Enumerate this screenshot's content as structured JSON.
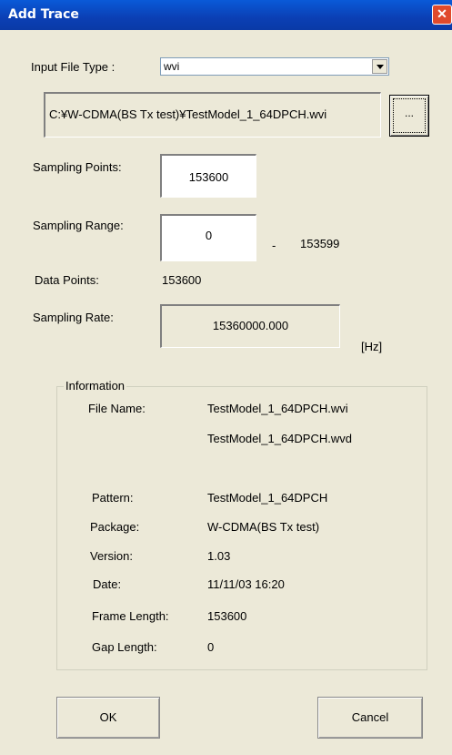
{
  "window": {
    "title": "Add Trace",
    "close_glyph": "✕"
  },
  "input_file_type": {
    "label": "Input File Type :",
    "value": "wvi"
  },
  "file_path": "C:¥W-CDMA(BS Tx test)¥TestModel_1_64DPCH.wvi",
  "browse_label": "...",
  "sampling_points": {
    "label": "Sampling Points:",
    "value": "153600"
  },
  "sampling_range": {
    "label": "Sampling Range:",
    "start": "0",
    "separator": "-",
    "end": "153599"
  },
  "data_points": {
    "label": "Data Points:",
    "value": "153600"
  },
  "sampling_rate": {
    "label": "Sampling Rate:",
    "value": "15360000.000",
    "unit": "[Hz]"
  },
  "information": {
    "title": "Information",
    "file_name_label": "File Name:",
    "file_name_1": "TestModel_1_64DPCH.wvi",
    "file_name_2": "TestModel_1_64DPCH.wvd",
    "pattern_label": "Pattern:",
    "pattern": "TestModel_1_64DPCH",
    "package_label": "Package:",
    "package": "W-CDMA(BS Tx test)",
    "version_label": "Version:",
    "version": "1.03",
    "date_label": "Date:",
    "date": "11/11/03 16:20",
    "frame_length_label": "Frame Length:",
    "frame_length": "153600",
    "gap_length_label": "Gap Length:",
    "gap_length": "0"
  },
  "buttons": {
    "ok": "OK",
    "cancel": "Cancel"
  }
}
